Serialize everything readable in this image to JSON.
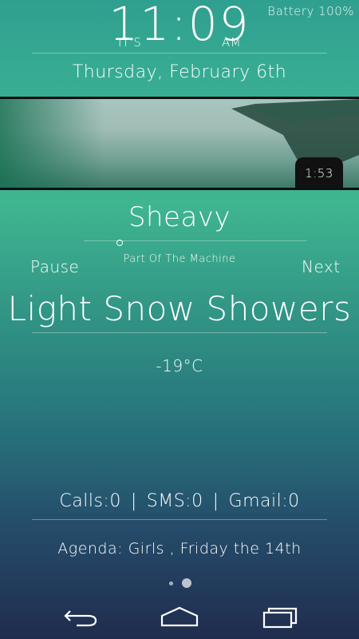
{
  "status": {
    "battery": "Battery 100%"
  },
  "clock": {
    "prefix": "IT'S",
    "time": "11:09",
    "suffix": "AM",
    "date": "Thursday, February 6th"
  },
  "photo": {
    "timer": "1:53"
  },
  "music": {
    "artist": "Sheavy",
    "song": "Part Of The Machine",
    "pause_label": "Pause",
    "next_label": "Next"
  },
  "weather": {
    "condition": "Light Snow Showers",
    "temperature": "-19°C"
  },
  "notifications": {
    "calls": "Calls:0",
    "sms": "SMS:0",
    "gmail": "Gmail:0",
    "separator": "|"
  },
  "agenda": {
    "text": "Agenda: Girls , Friday the 14th"
  },
  "nav": {
    "icons": [
      "back-icon",
      "home-icon",
      "recent-apps-icon"
    ]
  }
}
